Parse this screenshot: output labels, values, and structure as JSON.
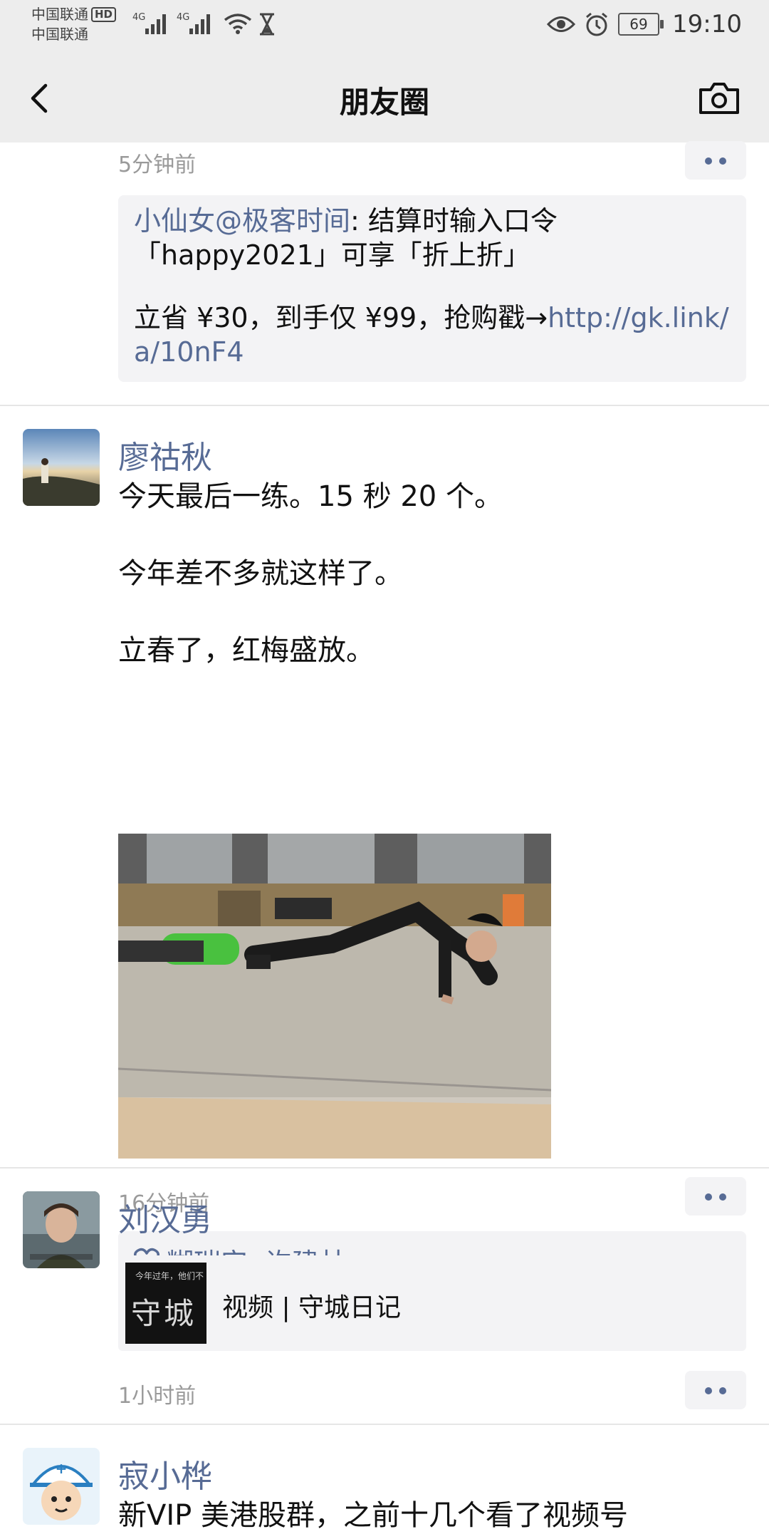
{
  "status": {
    "carrier1": "中国联通",
    "carrier2": "中国联通",
    "hd": "HD",
    "net1": "4G",
    "net2": "4G",
    "battery": "69",
    "time": "19:10"
  },
  "nav": {
    "title": "朋友圈"
  },
  "post0": {
    "time": "5分钟前",
    "comment_author": "小仙女@极客时间",
    "comment_line1": ": 结算时输入口令",
    "comment_line2": "「happy2021」可享「折上折」",
    "comment_line3": "立省 ¥30，到手仅 ¥99，抢购戳→",
    "comment_link_part1": "http://gk.link/",
    "comment_link_part2": "a/10nF4"
  },
  "post1": {
    "author": "廖祜秋",
    "text_line1": "今天最后一练。15 秒 20 个。",
    "text_line2": "今年差不多就这样了。",
    "text_line3": "立春了，红梅盛放。",
    "time": "16分钟前",
    "likes": "糊瑞安, 许建林"
  },
  "post2": {
    "author": "刘汉勇",
    "video_label": "视频 | 守城日记",
    "thumb_text": "守城",
    "thumb_caption": "今年过年，他们不",
    "time": "1小时前"
  },
  "post3": {
    "author": "寂小桦",
    "text_line1": "新VIP 美港股群，之前十几个看了视频号"
  },
  "colors": {
    "link": "#576b95",
    "bar_bg": "#ededed",
    "time": "#9a9a9a"
  }
}
